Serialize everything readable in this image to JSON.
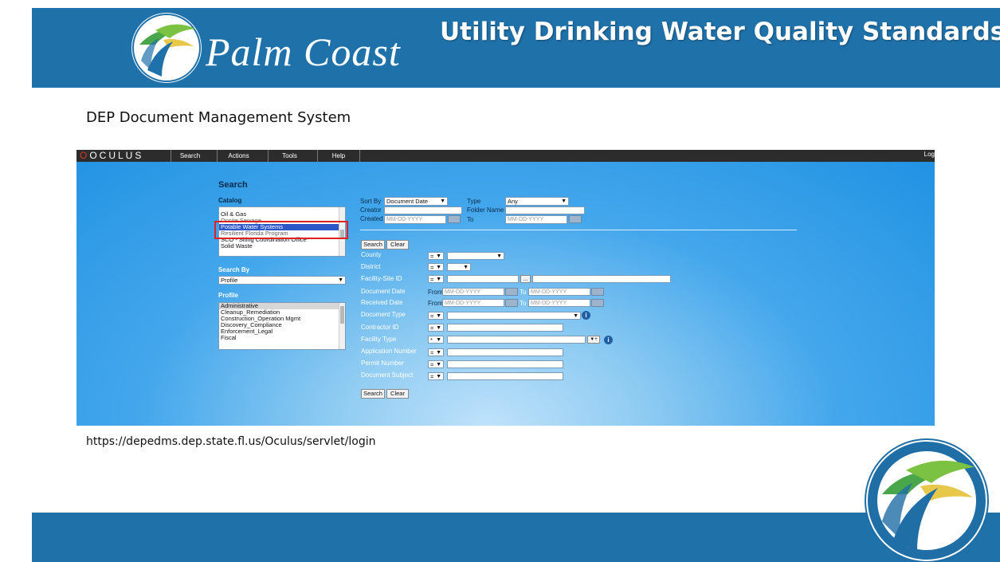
{
  "slide": {
    "brand": "Palm Coast",
    "title": "Utility Drinking Water Quality Standards",
    "subtitle": "DEP Document Management System",
    "url": "https://depedms.dep.state.fl.us/Oculus/servlet/login"
  },
  "colors": {
    "header_blue": "#1f71aa",
    "app_blue": "#1f91e2",
    "highlight_red": "#e1211f",
    "logo_green": "#4aa64a",
    "logo_yellow": "#e8c84a"
  },
  "app": {
    "brand": "OCULUS",
    "menu": [
      "Search",
      "Actions",
      "Tools",
      "Help"
    ],
    "log": "Log",
    "search_heading": "Search",
    "catalog_label": "Catalog",
    "catalog_items": [
      "Oil & Gas",
      "Onsite Sewage",
      "Potable Water Systems",
      "Resilient Florida Program",
      "SCO - Siting Coordination Office",
      "Solid Waste"
    ],
    "search_by_label": "Search By",
    "search_by_value": "Profile",
    "profile_label": "Profile",
    "profile_items": [
      "Administrative",
      "Cleanup_Remediation",
      "Construction_Operation Mgmt",
      "Discovery_Compliance",
      "Enforcement_Legal",
      "Fiscal"
    ],
    "sort_by_label": "Sort By",
    "sort_by_value": "Document Date",
    "type_label": "Type",
    "type_value": "Any",
    "creator_label": "Creator",
    "folder_name_label": "Folder Name",
    "created_label": "Created",
    "to_label": "To",
    "from_label": "From",
    "date_placeholder": "MM-DD-YYYY",
    "search_button": "Search",
    "clear_button": "Clear",
    "operator_eq": "=",
    "operator_star": "*",
    "ellipsis_button": "...",
    "type_button": "▼+",
    "info_glyph": "i",
    "fields": [
      "County",
      "District",
      "Facility-Site ID",
      "Document Date",
      "Received Date",
      "Document Type",
      "Contractor ID",
      "Facility Type",
      "Application Number",
      "Permit Number",
      "Document Subject"
    ]
  }
}
